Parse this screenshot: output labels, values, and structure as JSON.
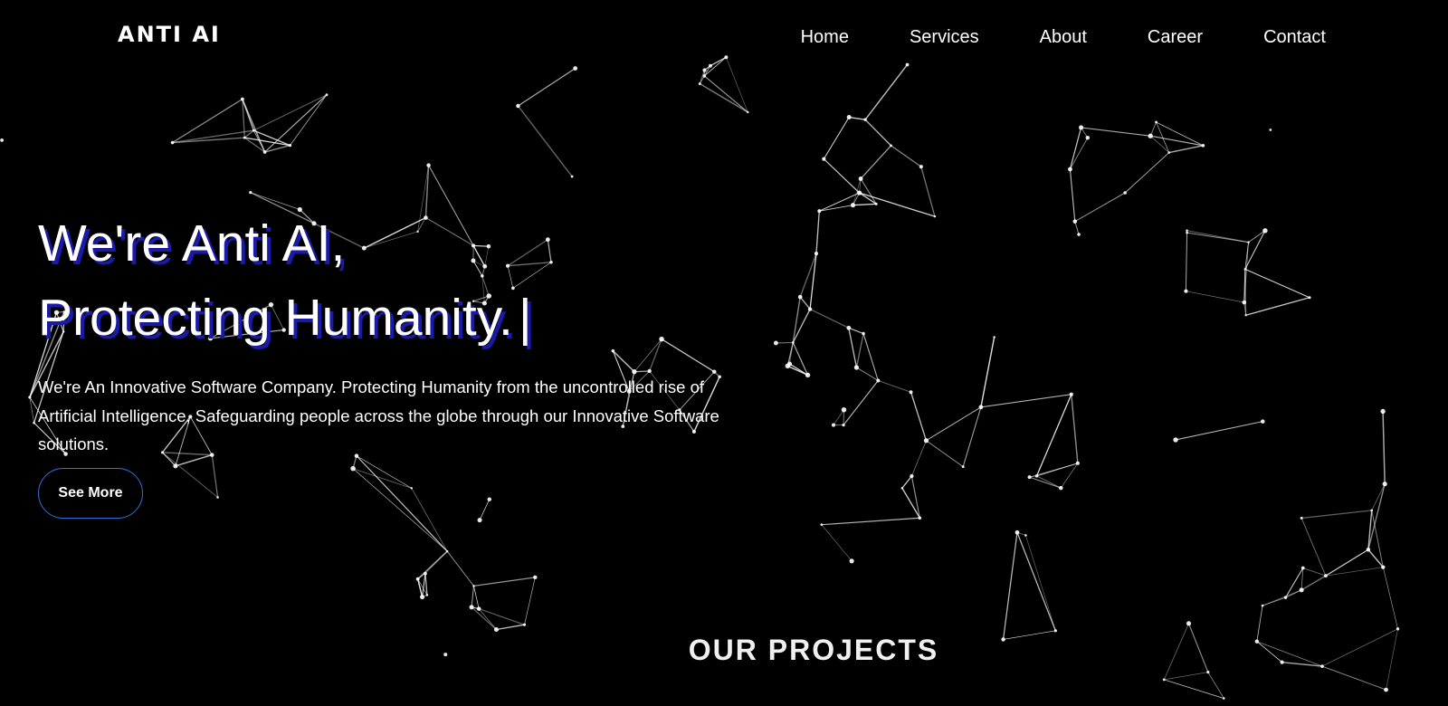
{
  "brand": {
    "logo_text": "ANTI AI"
  },
  "nav": {
    "items": [
      {
        "label": "Home"
      },
      {
        "label": "Services"
      },
      {
        "label": "About"
      },
      {
        "label": "Career"
      },
      {
        "label": "Contact"
      }
    ]
  },
  "hero": {
    "title_line1": "We're Anti AI,",
    "title_line2": "Protecting Humanity.",
    "cursor": "|",
    "description": "We're An Innovative Software Company. Protecting Humanity from the uncontrolled rise of Artificial Intelligence, Safeguarding people across the globe through our Innovative Software solutions.",
    "cta_label": "See More"
  },
  "projects": {
    "heading": "OUR PROJECTS"
  },
  "colors": {
    "background": "#000000",
    "text": "#ffffff",
    "title_shadow": "#1a1aa8",
    "button_border": "#2f72d6",
    "network_lines": "#ffffff"
  },
  "background": {
    "graphic": "particle-network"
  }
}
